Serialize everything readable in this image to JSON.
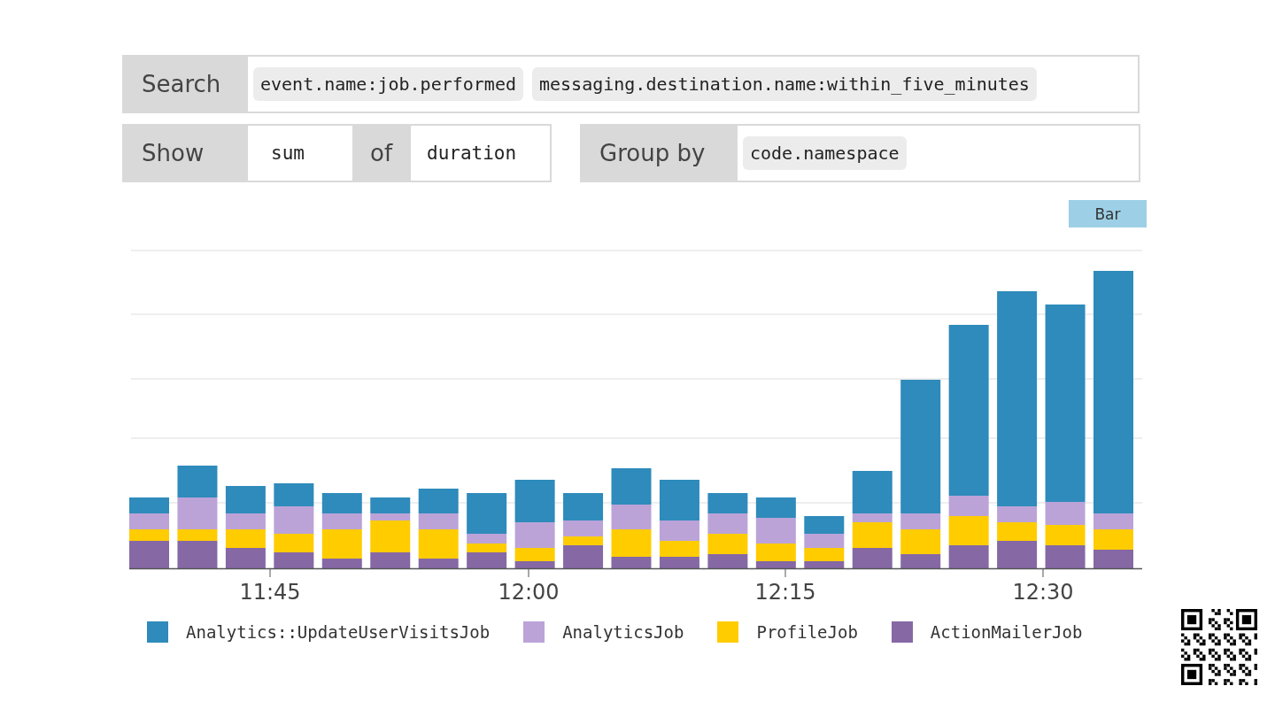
{
  "search": {
    "label": "Search",
    "terms": [
      "event.name:job.performed",
      "messaging.destination.name:within_five_minutes"
    ]
  },
  "show": {
    "label": "Show",
    "aggregate": "sum",
    "of_label": "of",
    "field": "duration"
  },
  "group_by": {
    "label": "Group by",
    "terms": [
      "code.namespace"
    ]
  },
  "chart_type_button": {
    "label": "Bar"
  },
  "chart": {
    "x_tick_labels": [
      "11:45",
      "12:00",
      "12:15",
      "12:30"
    ],
    "legend": [
      {
        "name": "Analytics::UpdateUserVisitsJob",
        "color": "#2e8bbb"
      },
      {
        "name": "AnalyticsJob",
        "color": "#bba3d8"
      },
      {
        "name": "ProfileJob",
        "color": "#ffcc00"
      },
      {
        "name": "ActionMailerJob",
        "color": "#8668a5"
      }
    ]
  }
}
